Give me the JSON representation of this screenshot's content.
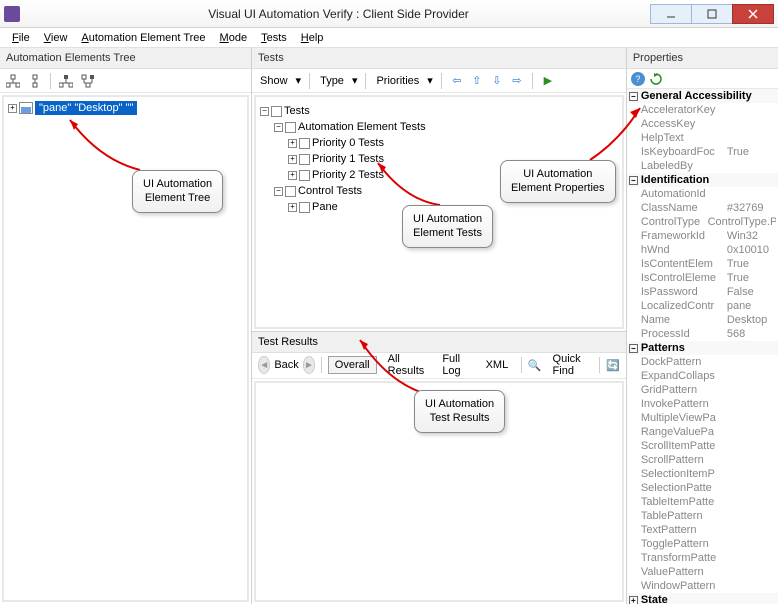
{
  "window": {
    "title": "Visual UI Automation Verify : Client Side Provider"
  },
  "menu": {
    "file": "File",
    "view": "View",
    "aet": "Automation Element Tree",
    "mode": "Mode",
    "tests": "Tests",
    "help": "Help"
  },
  "left": {
    "header": "Automation Elements Tree",
    "node": "\"pane\" \"Desktop\" \"\""
  },
  "tests": {
    "header": "Tests",
    "show": "Show",
    "type": "Type",
    "priorities": "Priorities",
    "root": "Tests",
    "aet": "Automation Element Tests",
    "p0": "Priority 0 Tests",
    "p1": "Priority 1 Tests",
    "p2": "Priority 2 Tests",
    "ctrl": "Control Tests",
    "pane": "Pane"
  },
  "results": {
    "header": "Test Results",
    "back": "Back",
    "overall": "Overall",
    "all": "All Results",
    "full": "Full Log",
    "xml": "XML",
    "quick": "Quick Find"
  },
  "props": {
    "header": "Properties",
    "g1": "General Accessibility",
    "g2": "Identification",
    "g3": "Patterns",
    "g4": "State",
    "rows1": [
      {
        "k": "AcceleratorKey",
        "v": ""
      },
      {
        "k": "AccessKey",
        "v": ""
      },
      {
        "k": "HelpText",
        "v": ""
      },
      {
        "k": "IsKeyboardFoc",
        "v": "True"
      },
      {
        "k": "LabeledBy",
        "v": ""
      }
    ],
    "rows2": [
      {
        "k": "AutomationId",
        "v": ""
      },
      {
        "k": "ClassName",
        "v": "#32769"
      },
      {
        "k": "ControlType",
        "v": "ControlType.Pane"
      },
      {
        "k": "FrameworkId",
        "v": "Win32"
      },
      {
        "k": "hWnd",
        "v": "0x10010"
      },
      {
        "k": "IsContentElem",
        "v": "True"
      },
      {
        "k": "IsControlEleme",
        "v": "True"
      },
      {
        "k": "IsPassword",
        "v": "False"
      },
      {
        "k": "LocalizedContr",
        "v": "pane"
      },
      {
        "k": "Name",
        "v": "Desktop"
      },
      {
        "k": "ProcessId",
        "v": "568"
      }
    ],
    "rows3": [
      "DockPattern",
      "ExpandCollaps",
      "GridPattern",
      "InvokePattern",
      "MultipleViewPa",
      "RangeValuePa",
      "ScrollItemPatte",
      "ScrollPattern",
      "SelectionItemP",
      "SelectionPatte",
      "TableItemPatte",
      "TablePattern",
      "TextPattern",
      "TogglePattern",
      "TransformPatte",
      "ValuePattern",
      "WindowPattern"
    ]
  },
  "callouts": {
    "c1": "UI Automation\nElement Tree",
    "c2": "UI Automation\nElement Tests",
    "c3": "UI Automation\nElement Properties",
    "c4": "UI Automation\nTest Results"
  }
}
